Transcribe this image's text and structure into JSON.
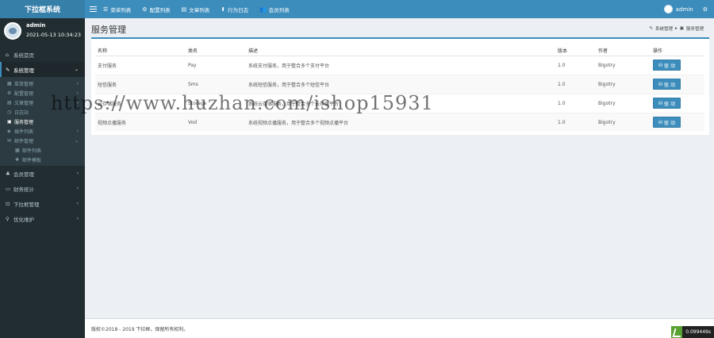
{
  "header": {
    "brand": "下拉框系统",
    "nav": [
      {
        "icon": "list-icon",
        "glyph": "☰",
        "label": "菜单列表"
      },
      {
        "icon": "gear-icon",
        "glyph": "⚙",
        "label": "配置列表"
      },
      {
        "icon": "document-icon",
        "glyph": "▤",
        "label": "文章列表"
      },
      {
        "icon": "log-icon",
        "glyph": "⬆",
        "label": "行为日志"
      },
      {
        "icon": "users-icon",
        "glyph": "👥",
        "label": "会员列表"
      }
    ],
    "user": "admin"
  },
  "sidebar": {
    "user_name": "admin",
    "user_time": "2021-05-13 10:34:23",
    "items": [
      {
        "label": "系统首页",
        "glyph": "⌂"
      },
      {
        "label": "系统管理",
        "glyph": "✎"
      },
      {
        "label": "会员管理",
        "glyph": "♣"
      },
      {
        "label": "财务统计",
        "glyph": "▭"
      },
      {
        "label": "下拉框管理",
        "glyph": "⊡"
      },
      {
        "label": "优化维护",
        "glyph": "⚲"
      }
    ],
    "sub_items": [
      {
        "label": "菜单管理",
        "glyph": "▦"
      },
      {
        "label": "配置管理",
        "glyph": "⚙"
      },
      {
        "label": "文章管理",
        "glyph": "▤"
      },
      {
        "label": "日志站",
        "glyph": "◷"
      },
      {
        "label": "服务管理",
        "glyph": "▣"
      },
      {
        "label": "插件列表",
        "glyph": "◈"
      },
      {
        "label": "邮件管理",
        "glyph": "✉"
      }
    ],
    "sub_sub_items": [
      {
        "label": "邮件列表",
        "glyph": "▦"
      },
      {
        "label": "邮件模板",
        "glyph": "✚"
      }
    ]
  },
  "page": {
    "title": "服务管理",
    "breadcrumb": [
      "系统管理",
      "服务管理"
    ]
  },
  "table": {
    "columns": [
      "名称",
      "类名",
      "描述",
      "版本",
      "作者",
      "操作"
    ],
    "rows": [
      {
        "name": "支付服务",
        "class": "Pay",
        "desc": "系统支付服务，用于整合多个支付平台",
        "version": "1.0",
        "author": "Bigotry"
      },
      {
        "name": "短信服务",
        "class": "Sms",
        "desc": "系统短信服务，用于整合多个短信平台",
        "version": "1.0",
        "author": "Bigotry"
      },
      {
        "name": "云存储服务",
        "class": "Storage",
        "desc": "系统云存储服务，用于整合多个云存储平台",
        "version": "1.0",
        "author": "Bigotry"
      },
      {
        "name": "视频点播服务",
        "class": "Vod",
        "desc": "系统视频点播服务，用于整合多个视频点播平台",
        "version": "1.0",
        "author": "Bigotry"
      }
    ],
    "action_label": "驱 动"
  },
  "watermark": "https://www.huzhan.com/ishop15931",
  "footer": {
    "copyright": "版权©2018 - 2019 下拉框，保留所有权利。",
    "timing": "0.099449s"
  }
}
